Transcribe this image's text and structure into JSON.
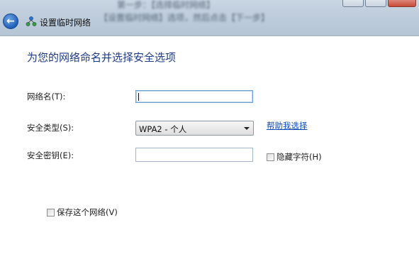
{
  "window": {
    "title": "设置临时网络",
    "background_text_1": "第一步：【选择临时网络】",
    "background_text_2": "【设置临时网络】选项，然后点击【下一步】"
  },
  "icons": {
    "back": "back-arrow-icon",
    "network": "network-icon",
    "dropdown": "chevron-down-icon"
  },
  "page": {
    "heading": "为您的网络命名并选择安全选项"
  },
  "form": {
    "network_name_label": "网络名(T):",
    "network_name_value": "",
    "security_type_label": "安全类型(S):",
    "security_type_value": "WPA2 - 个人",
    "help_link": "帮助我选择",
    "security_key_label": "安全密钥(E):",
    "security_key_value": "",
    "hide_chars_label": "隐藏字符(H)",
    "hide_chars_checked": false,
    "save_network_label": "保存这个网络(V)",
    "save_network_checked": false
  },
  "colors": {
    "heading": "#1e3c8c",
    "link": "#0a4ac4",
    "titlebar": "#bfcddc"
  }
}
